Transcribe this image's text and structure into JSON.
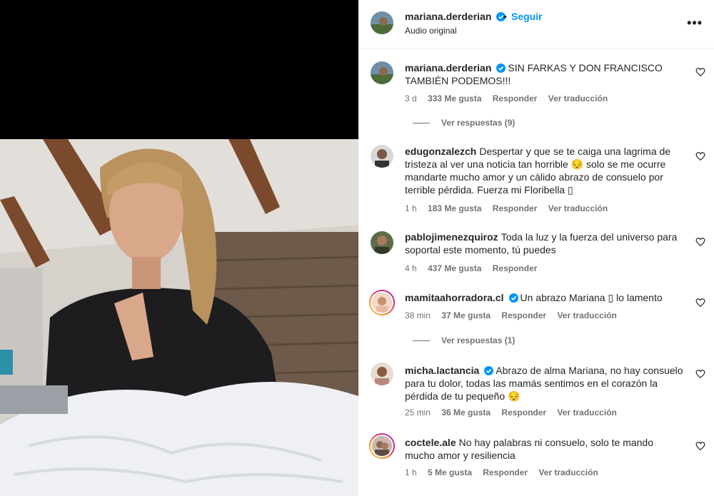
{
  "post": {
    "username": "mariana.derderian",
    "follow_label": "Seguir",
    "dot": "•",
    "audio": "Audio original",
    "more": "•••"
  },
  "colors": {
    "accent": "#0095f6",
    "verified": "#0095f6",
    "muted": "#737373",
    "text": "#262626"
  },
  "comments": [
    {
      "username": "mariana.derderian",
      "verified": true,
      "text": "SIN FARKAS Y DON FRANCISCO TAMBIÉN PODEMOS!!!",
      "time": "3 d",
      "likes": "333 Me gusta",
      "reply": "Responder",
      "translate": "Ver traducción",
      "view_replies": "Ver respuestas (9)"
    },
    {
      "username": "edugonzalezch",
      "verified": false,
      "text": "Despertar y que se te caiga una lagrima de tristeza al ver una noticia tan horrible 😔 solo se me ocurre mandarte mucho amor y un cálido abrazo de consuelo por terrible pérdida. Fuerza mi Floribella ▯",
      "time": "1 h",
      "likes": "183 Me gusta",
      "reply": "Responder",
      "translate": "Ver traducción"
    },
    {
      "username": "pablojimenezquiroz",
      "verified": false,
      "text": "Toda la luz y la fuerza del universo para soportal este momento, tú puedes",
      "time": "4 h",
      "likes": "437 Me gusta",
      "reply": "Responder"
    },
    {
      "username": "mamitaahorradora.cl",
      "verified": true,
      "text": "Un abrazo Mariana ▯ lo lamento",
      "time": "38 min",
      "likes": "37 Me gusta",
      "reply": "Responder",
      "translate": "Ver traducción",
      "view_replies": "Ver respuestas (1)"
    },
    {
      "username": "micha.lactancia",
      "verified": true,
      "text": "Abrazo de alma Mariana, no hay consuelo para tu dolor, todas las mamás sentimos en el corazón la pérdida de tu pequeño 😔",
      "time": "25 min",
      "likes": "36 Me gusta",
      "reply": "Responder",
      "translate": "Ver traducción"
    },
    {
      "username": "coctele.ale",
      "verified": false,
      "text": "No hay palabras ni consuelo, solo te mando mucho amor y resiliencia",
      "time": "1 h",
      "likes": "5 Me gusta",
      "reply": "Responder",
      "translate": "Ver traducción"
    }
  ]
}
